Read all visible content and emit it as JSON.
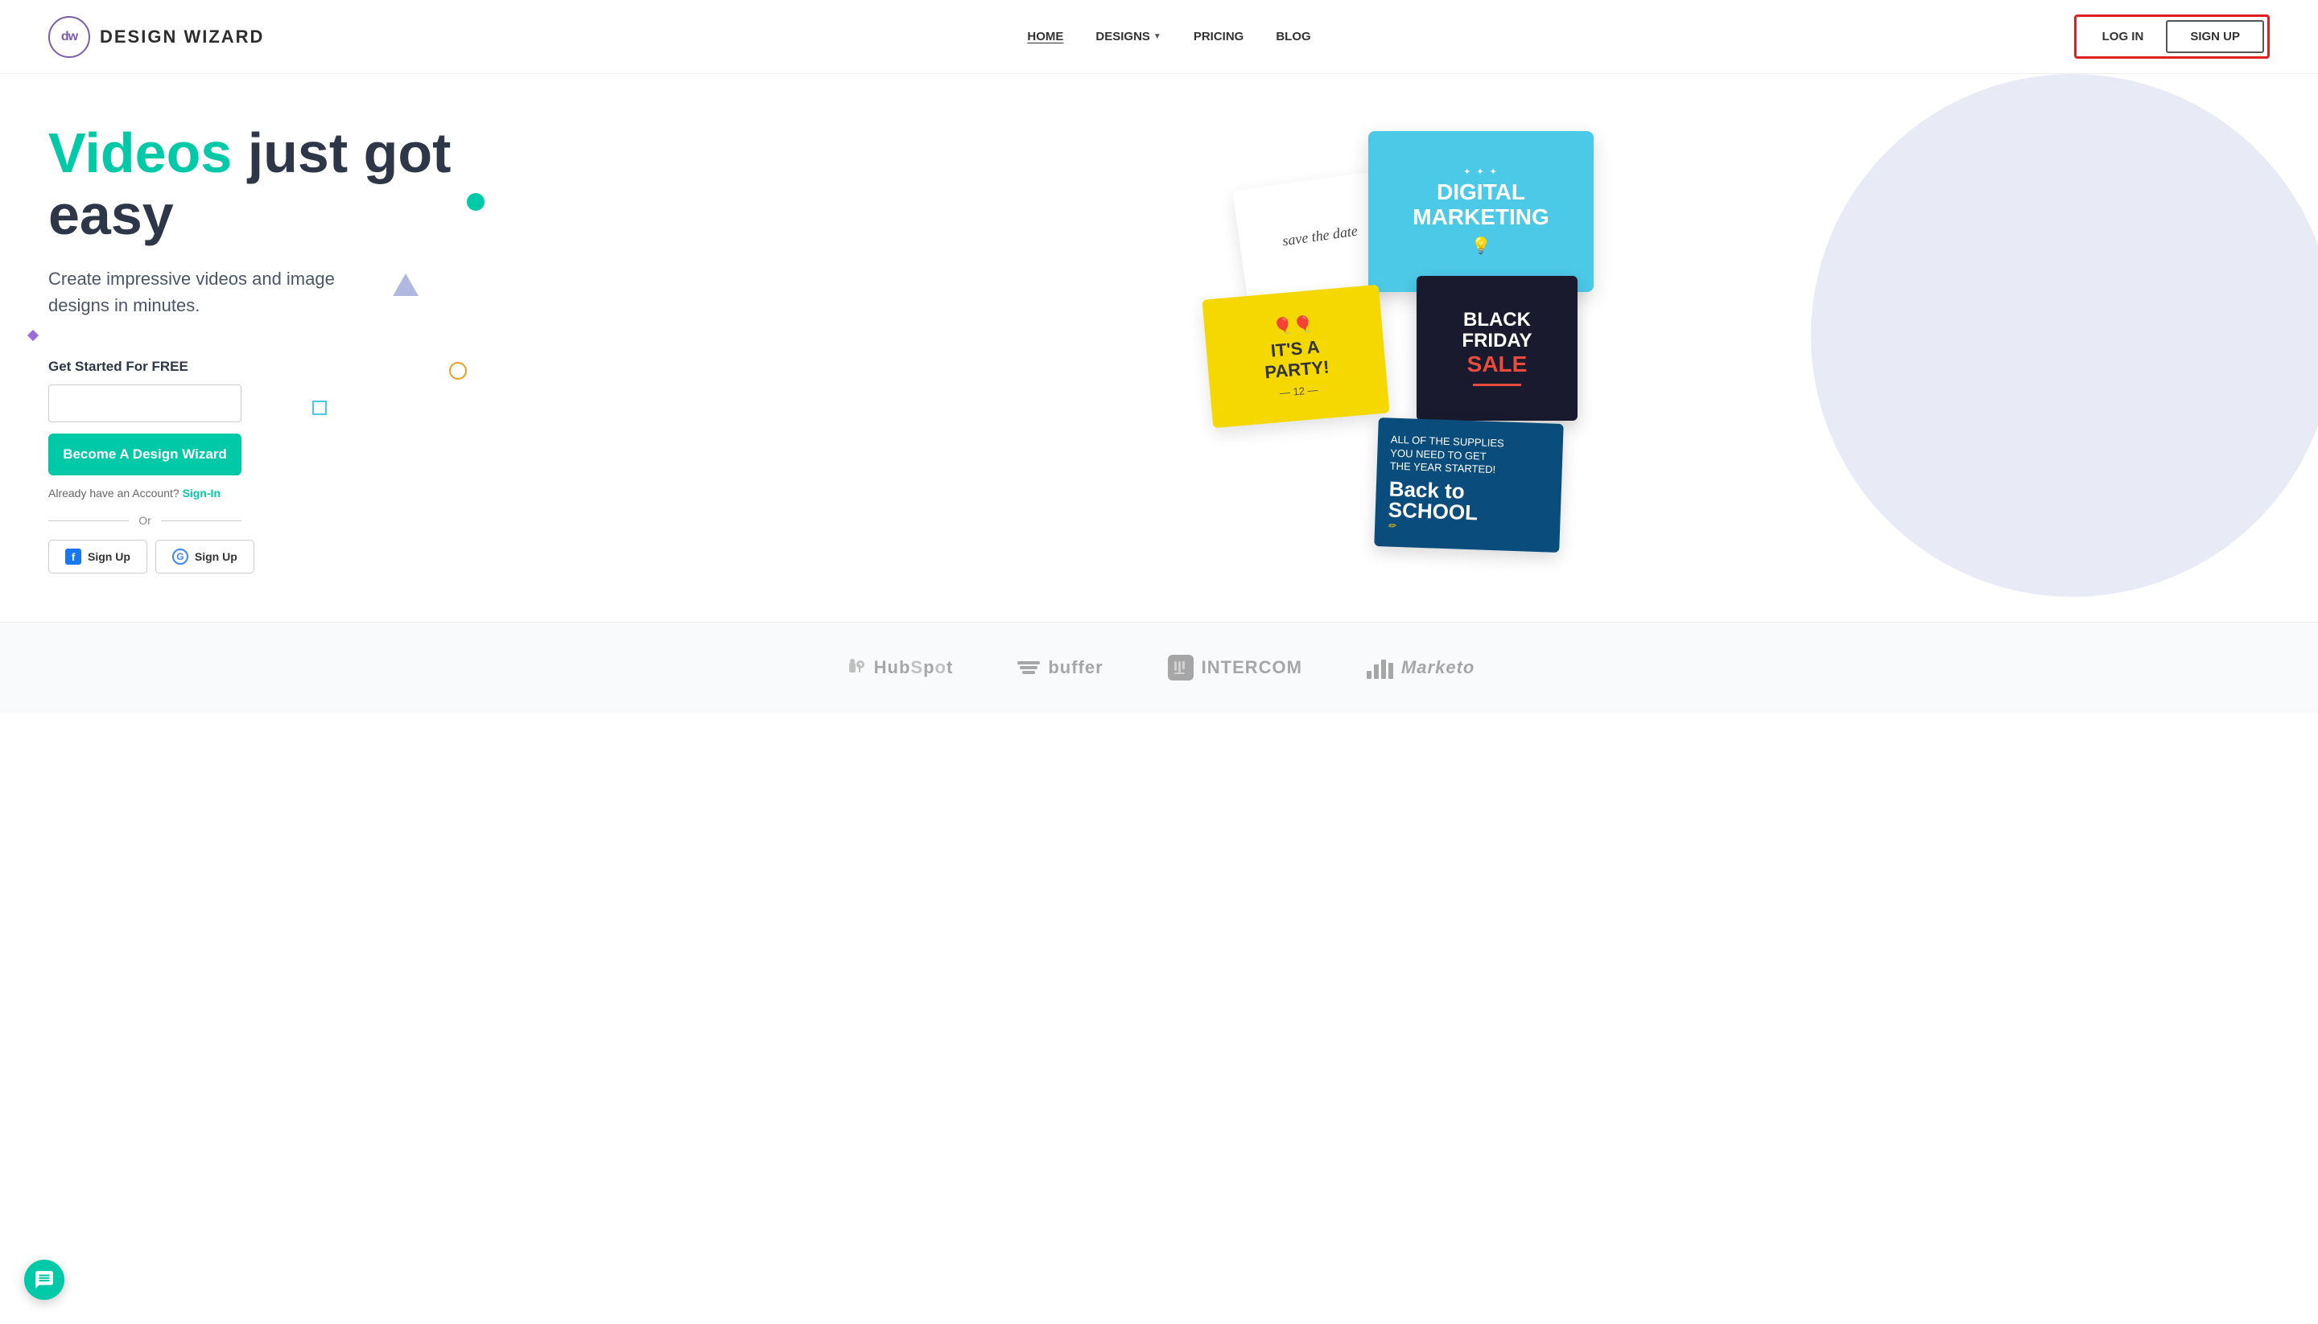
{
  "brand": {
    "logo_initials": "dw",
    "name": "DESIGN WIZARD"
  },
  "nav": {
    "items": [
      {
        "label": "HOME",
        "active": true
      },
      {
        "label": "DESIGNS",
        "has_dropdown": true
      },
      {
        "label": "PRICING",
        "active": false
      },
      {
        "label": "BLOG",
        "active": false
      }
    ],
    "login_label": "LOG IN",
    "signup_label": "SIGN UP"
  },
  "hero": {
    "title_highlight": "Videos",
    "title_rest": " just got easy",
    "subtitle": "Create impressive videos and image designs in minutes.",
    "get_started_label": "Get Started For FREE",
    "email_placeholder": "",
    "become_button": "Become A Design Wizard",
    "already_account": "Already have an Account?",
    "signin_label": "Sign-In",
    "or_label": "Or",
    "facebook_signup": "Sign Up",
    "google_signup": "Sign Up"
  },
  "design_cards": {
    "monitor": "DIGITAL\nMARKETING",
    "savedate": "save the date",
    "party": "IT'S A\nPARTY!",
    "blackfriday_line1": "BLACK\nFRIDAY",
    "blackfriday_line2": "SALE",
    "backtoschool": "Back to\nSCHOOL"
  },
  "partners": [
    {
      "name": "HubSpot",
      "icon": "hubspot"
    },
    {
      "name": "buffer",
      "icon": "buffer"
    },
    {
      "name": "INTERCOM",
      "icon": "intercom"
    },
    {
      "name": "Marketo",
      "icon": "marketo"
    }
  ],
  "colors": {
    "teal": "#00c9a7",
    "purple": "#7b5ea7",
    "dark": "#2d3748",
    "highlight_red": "#e02020"
  }
}
